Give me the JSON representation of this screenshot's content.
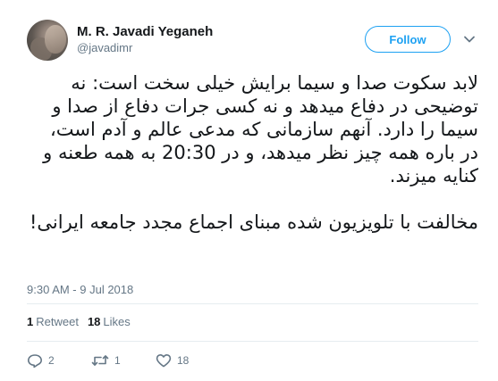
{
  "user": {
    "display_name": "M. R. Javadi Yeganeh",
    "screen_name": "@javadimr"
  },
  "follow_button": {
    "label": "Follow"
  },
  "tweet": {
    "paragraphs": [
      "لابد سکوت صدا و سیما برایش خیلی سخت است: نه توضیحی در دفاع میدهد و نه کسی جرات دفاع از صدا و سیما را دارد. آنهم سازمانی که مدعی عالم و آدم است، در باره همه چیز نظر میدهد، و در 20:30 به همه طعنه و کنایه میزند.",
      "مخالفت با تلویزیون شده مبنای اجماع مجدد جامعه ایرانی!"
    ],
    "timestamp": "9:30 AM - 9 Jul 2018"
  },
  "stats": {
    "retweets_count": "1",
    "retweets_label": "Retweet",
    "likes_count": "18",
    "likes_label": "Likes"
  },
  "actions": {
    "reply_count": "2",
    "retweet_count": "1",
    "like_count": "18"
  },
  "colors": {
    "accent": "#1da1f2",
    "secondary_text": "#657786",
    "divider": "#e6ecf0"
  },
  "icons": {
    "avatar": "avatar-photo",
    "caret": "chevron-down-icon",
    "reply": "reply-icon",
    "retweet": "retweet-icon",
    "like": "heart-icon"
  }
}
